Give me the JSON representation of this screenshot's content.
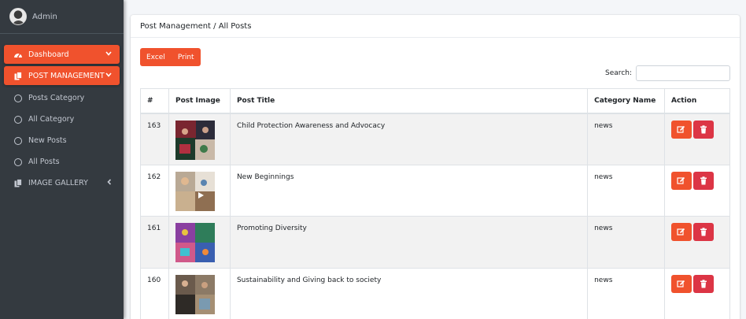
{
  "sidebar": {
    "user": "Admin",
    "items": [
      {
        "label": "Dashboard",
        "icon": "dashboard-icon"
      },
      {
        "label": "POST MANAGEMENT",
        "icon": "copy-icon"
      },
      {
        "label": "Posts Category",
        "icon": "circle-icon"
      },
      {
        "label": "All Category",
        "icon": "circle-icon"
      },
      {
        "label": "New Posts",
        "icon": "circle-icon"
      },
      {
        "label": "All Posts",
        "icon": "circle-icon"
      },
      {
        "label": "IMAGE GALLERY",
        "icon": "copy-icon"
      }
    ]
  },
  "header": {
    "breadcrumb": "Post Management / All Posts"
  },
  "toolbar": {
    "excel": "Excel",
    "print": "Print"
  },
  "search": {
    "label": "Search:",
    "value": ""
  },
  "table": {
    "headers": [
      "#",
      "Post Image",
      "Post Title",
      "Category Name",
      "Action"
    ],
    "rows": [
      {
        "id": "163",
        "title": "Child Protection Awareness and Advocacy",
        "category": "news"
      },
      {
        "id": "162",
        "title": "New Beginnings",
        "category": "news"
      },
      {
        "id": "161",
        "title": "Promoting Diversity",
        "category": "news"
      },
      {
        "id": "160",
        "title": "Sustainability and Giving back to society",
        "category": "news"
      }
    ]
  },
  "colors": {
    "accent": "#f0522d",
    "danger": "#dc3545",
    "sidebar": "#343a40"
  }
}
